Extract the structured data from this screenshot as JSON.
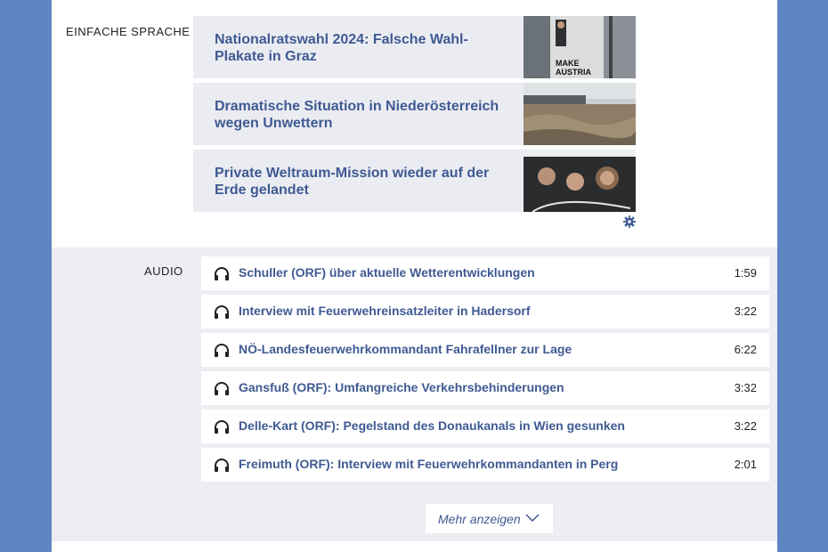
{
  "simple_language": {
    "label": "EINFACHE SPRACHE",
    "items": [
      {
        "title": "Nationalratswahl 2024: Falsche Wahl-Plakate in Graz",
        "thumb_text": "MAKE AUSTRIA GREAT"
      },
      {
        "title": "Dramatische Situation in Niederösterreich wegen Unwettern"
      },
      {
        "title": "Private Weltraum-Mission wieder auf der Erde gelandet"
      }
    ]
  },
  "audio": {
    "label": "AUDIO",
    "items": [
      {
        "title": "Schuller (ORF) über aktuelle Wetterentwicklungen",
        "duration": "1:59"
      },
      {
        "title": "Interview mit Feuerwehreinsatzleiter in Hadersorf",
        "duration": "3:22"
      },
      {
        "title": "NÖ-Landesfeuerwehrkommandant Fahrafellner zur Lage",
        "duration": "6:22"
      },
      {
        "title": "Gansfuß (ORF): Umfangreiche Verkehrsbehinderungen",
        "duration": "3:32"
      },
      {
        "title": "Delle-Kart (ORF): Pegelstand des Donaukanals in Wien gesunken",
        "duration": "3:22"
      },
      {
        "title": "Freimuth (ORF): Interview mit Feuerwehrkommandanten in Perg",
        "duration": "2:01"
      }
    ],
    "more_label": "Mehr anzeigen"
  },
  "icons": {
    "settings": "gear-icon",
    "audio": "headphones-icon",
    "more": "chevron-down-icon"
  },
  "colors": {
    "accent": "#3f5a93",
    "background": "#5f86c1",
    "card": "#ebecf2"
  }
}
